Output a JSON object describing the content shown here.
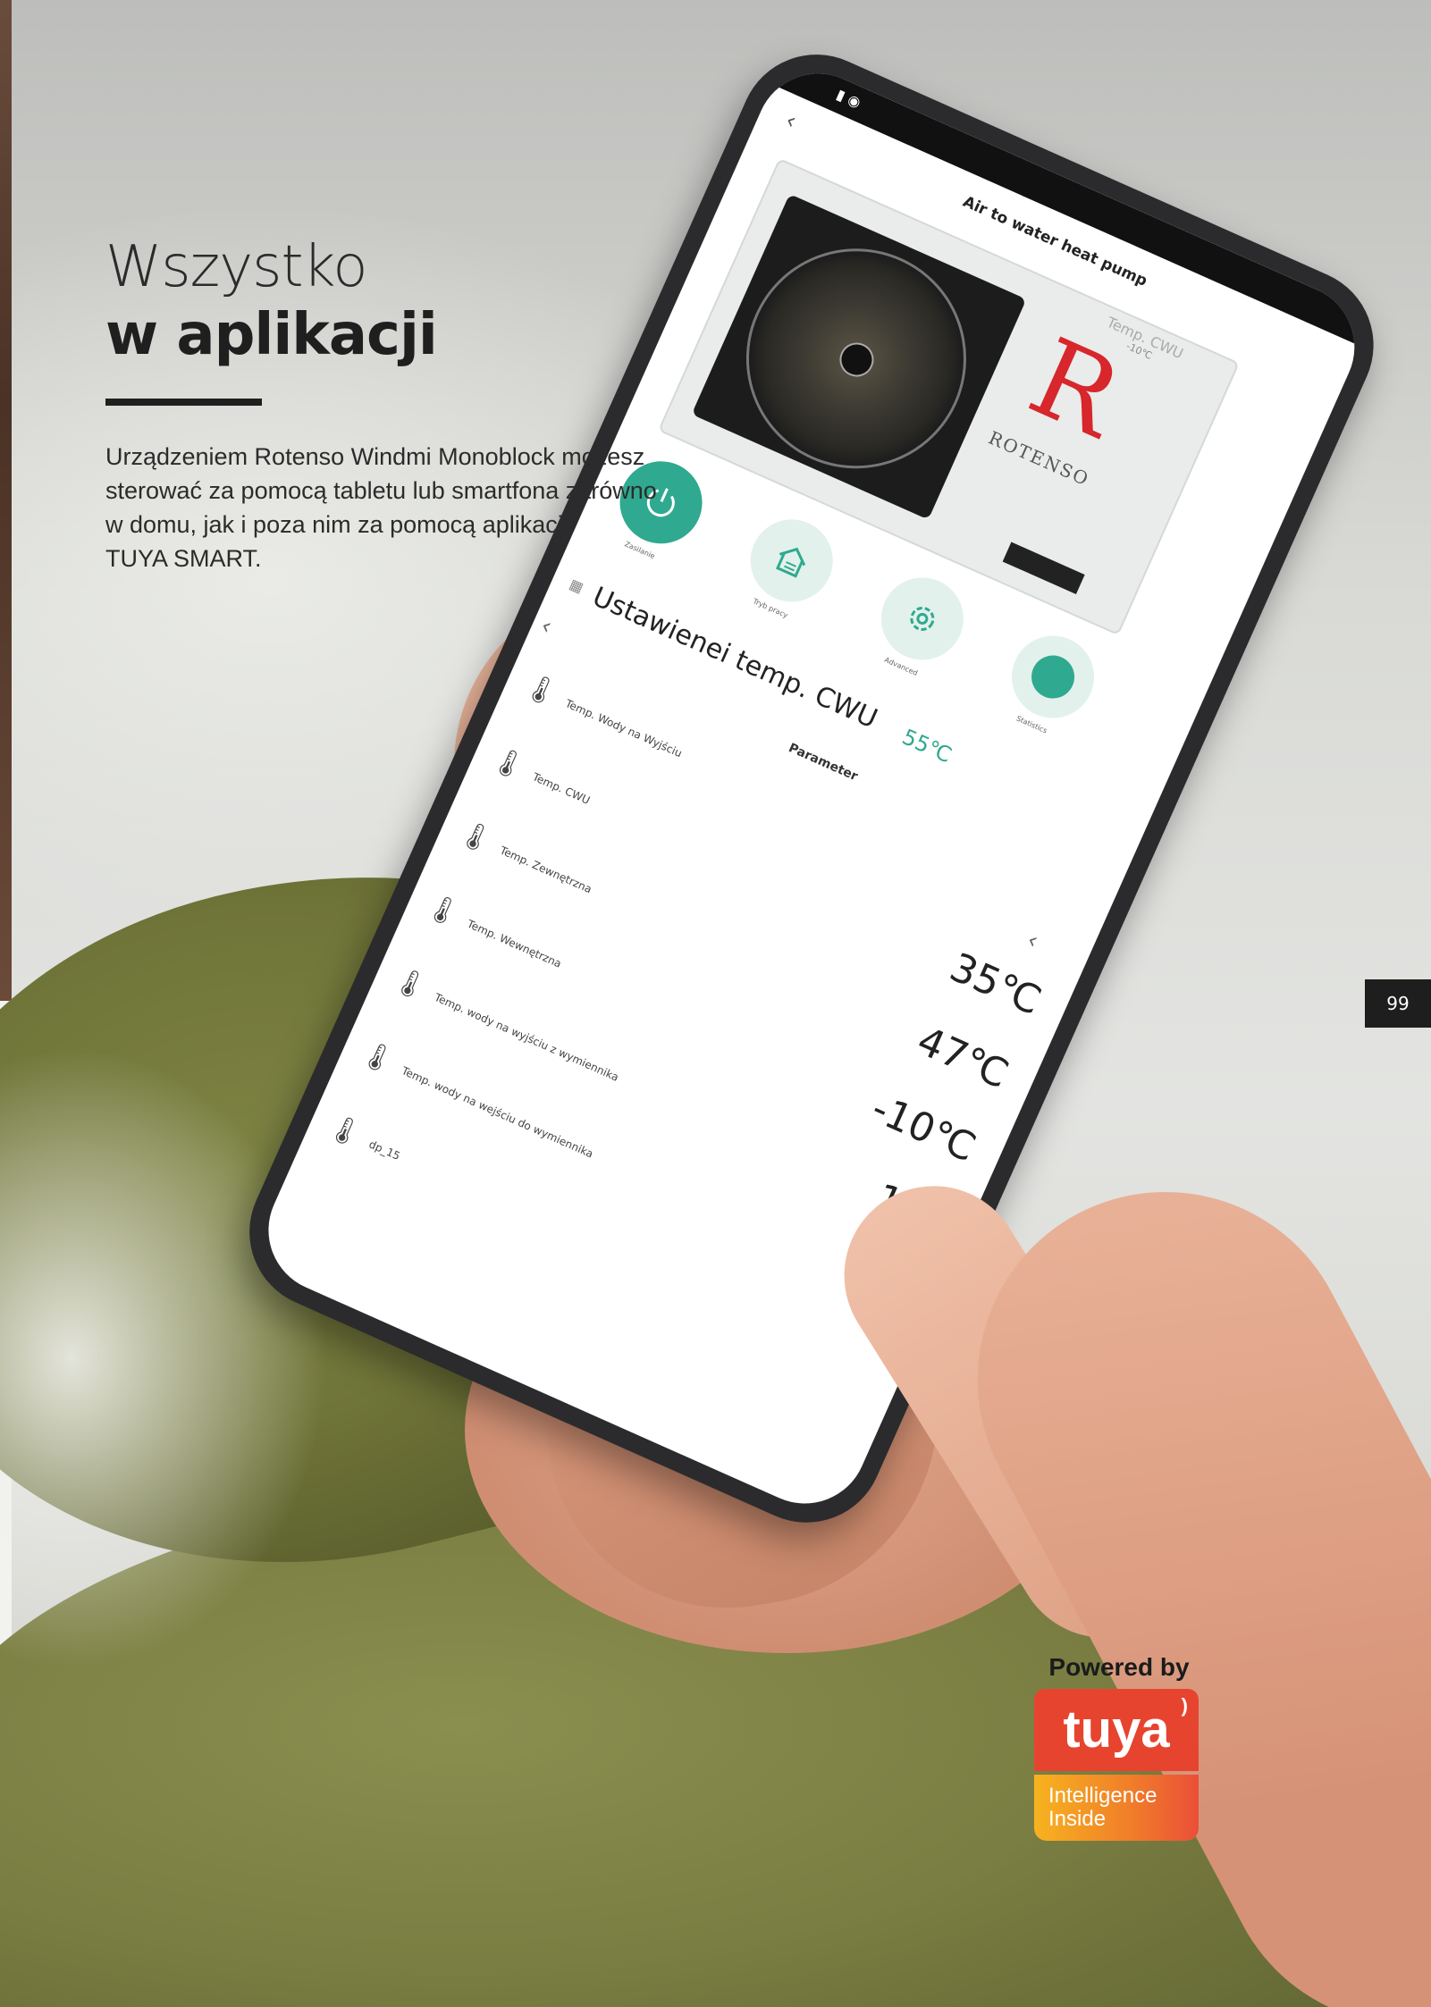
{
  "page": {
    "headline_light": "Wszystko",
    "headline_bold": "w aplikacji",
    "body_lines": [
      "Urządzeniem Rotenso Windmi Monoblock możesz",
      "sterować za pomocą tabletu lub smartfona zarówno",
      "w domu, jak i poza nim za pomocą aplikacji",
      "TUYA SMART."
    ],
    "page_number": "99"
  },
  "phone_app": {
    "title": "Air to water heat pump",
    "top_temp_label": "Temp. CWU",
    "top_temp_value": "-10℃",
    "brand": "ROTENSO",
    "buttons": [
      {
        "label": "Zasilanie",
        "icon": "power-icon"
      },
      {
        "label": "Tryb pracy",
        "icon": "house-mode-icon"
      },
      {
        "label": "Advanced",
        "icon": "gear-icon"
      },
      {
        "label": "Statistics",
        "icon": "statistics-icon"
      }
    ],
    "setting_label": "Ustawienei temp. CWU",
    "setting_value": "55℃",
    "parameter_heading": "Parameter",
    "parameters": [
      {
        "name": "Temp. Wody na Wyjściu",
        "value": ""
      },
      {
        "name": "Temp. CWU",
        "value": "35℃"
      },
      {
        "name": "Temp. Zewnętrzna",
        "value": "47℃"
      },
      {
        "name": "Temp. Wewnętrzna",
        "value": "-10℃"
      },
      {
        "name": "Temp. wody na wyjściu z wymiennika",
        "value": "1℃"
      },
      {
        "name": "Temp. wody na wejściu do wymiennika",
        "value": ""
      },
      {
        "name": "dp_15",
        "value": ""
      }
    ]
  },
  "badge": {
    "powered_by": "Powered by",
    "brand": "tuya",
    "tagline_1": "Intelligence",
    "tagline_2": "Inside"
  },
  "colors": {
    "accent_green": "#2fa98f",
    "tuya_red": "#e7442f",
    "rotenso_red": "#d7262c"
  }
}
